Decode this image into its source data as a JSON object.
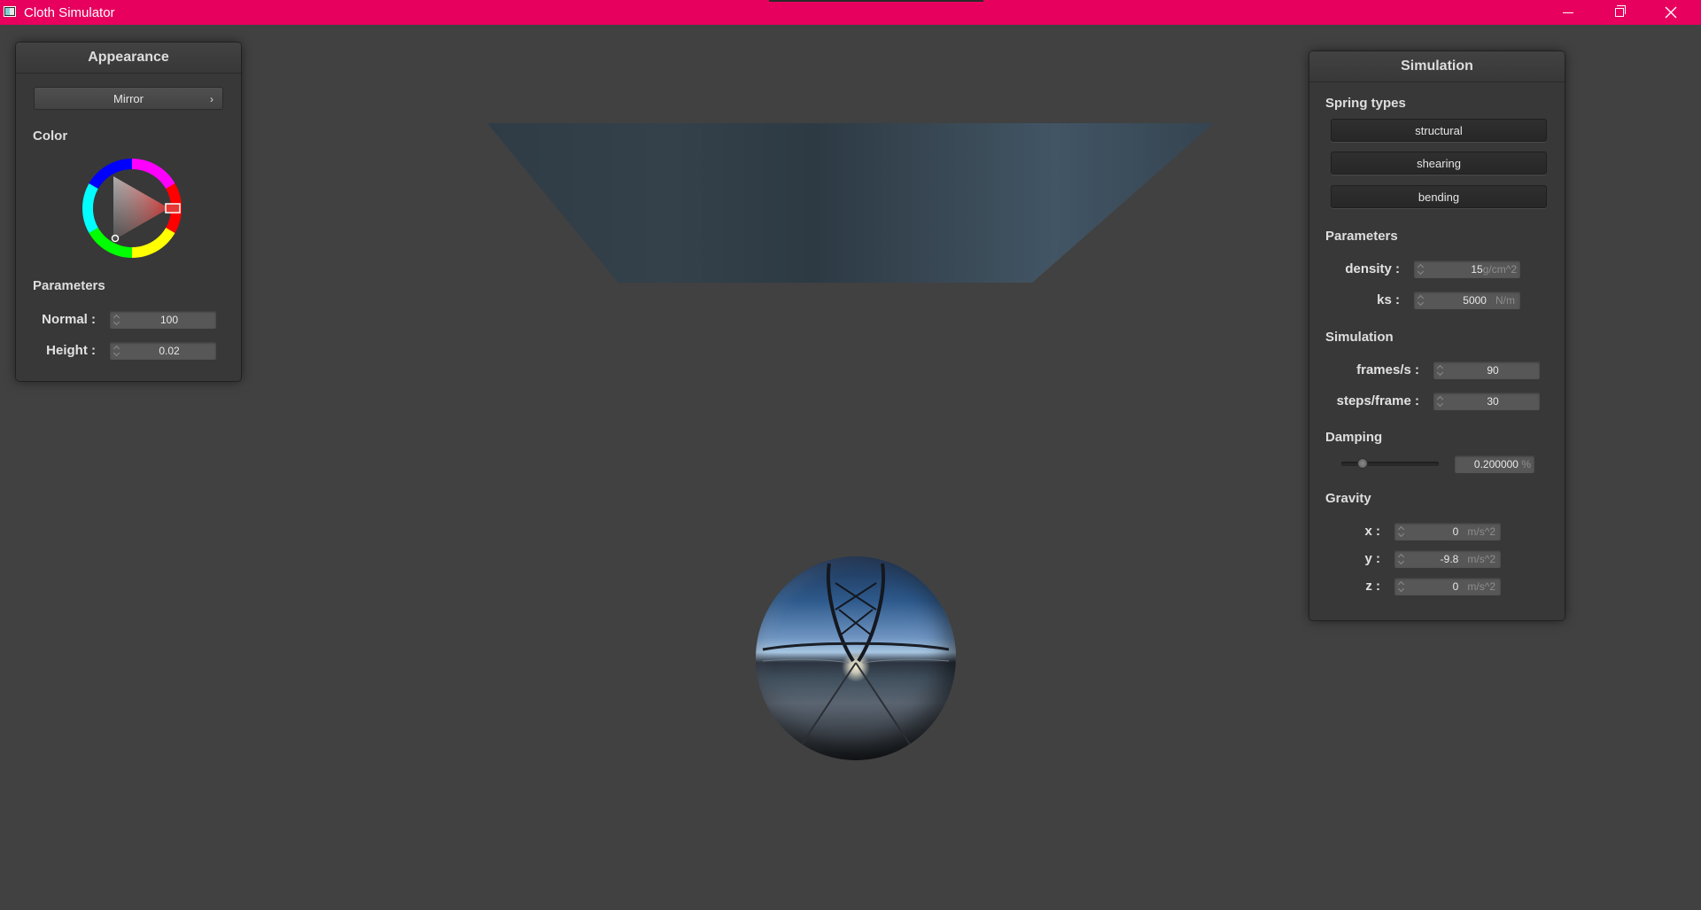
{
  "window": {
    "title": "Cloth Simulator"
  },
  "appearance": {
    "title": "Appearance",
    "material_button": "Mirror",
    "color_label": "Color",
    "selected_color": "#e53935",
    "parameters_label": "Parameters",
    "normal_label": "Normal :",
    "normal_value": "100",
    "height_label": "Height :",
    "height_value": "0.02"
  },
  "simulation": {
    "title": "Simulation",
    "spring_types_label": "Spring types",
    "spring_buttons": [
      "structural",
      "shearing",
      "bending"
    ],
    "parameters_label": "Parameters",
    "density_label": "density :",
    "density_value": "15",
    "density_unit": "g/cm^2",
    "ks_label": "ks :",
    "ks_value": "5000",
    "ks_unit": "N/m",
    "simulation_label": "Simulation",
    "fps_label": "frames/s :",
    "fps_value": "90",
    "steps_label": "steps/frame :",
    "steps_value": "30",
    "damping_label": "Damping",
    "damping_value": "0.200000",
    "damping_unit": "%",
    "damping_slider_fraction": 0.2,
    "gravity_label": "Gravity",
    "gravity_x_label": "x :",
    "gravity_x_value": "0",
    "gravity_y_label": "y :",
    "gravity_y_value": "-9.8",
    "gravity_z_label": "z :",
    "gravity_z_value": "0",
    "gravity_unit": "m/s^2"
  },
  "colors": {
    "titlebar": "#e8005f",
    "background": "#414141",
    "panel": "#383838"
  }
}
